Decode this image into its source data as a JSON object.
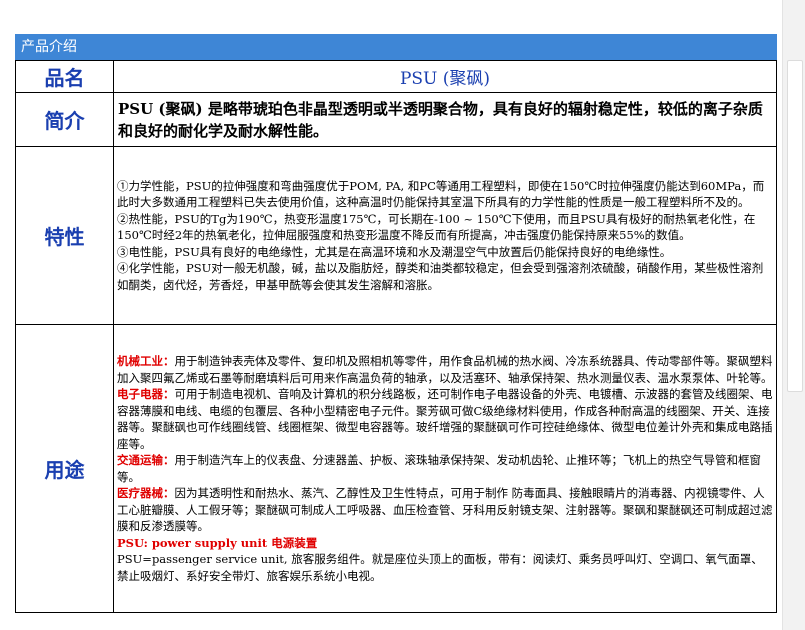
{
  "header": {
    "title": "产品介绍"
  },
  "labels": {
    "name": "品名",
    "intro": "简介",
    "features": "特性",
    "uses": "用途"
  },
  "product": {
    "name": "PSU (聚砜)",
    "intro": "PSU (聚砜) 是略带琥珀色非晶型透明或半透明聚合物，具有良好的辐射稳定性，较低的离子杂质和良好的耐化学及耐水解性能。"
  },
  "features": [
    "①力学性能，PSU的拉伸强度和弯曲强度优于POM, PA, 和PC等通用工程塑料，即使在150℃时拉伸强度仍能达到60MPa，而此时大多数通用工程塑料已失去使用价值，这种高温时仍能保持其室温下所具有的力学性能的性质是一般工程塑料所不及的。",
    "②热性能，PSU的Tg为190℃，热变形温度175℃，可长期在-100 ~ 150℃下使用，而且PSU具有极好的耐热氧老化性，在150℃时经2年的热氧老化，拉伸屈服强度和热变形温度不降反而有所提高，冲击强度仍能保持原来55%的数值。",
    "③电性能，PSU具有良好的电绝缘性，尤其是在高温环境和水及潮湿空气中放置后仍能保持良好的电绝缘性。",
    "④化学性能，PSU对一般无机酸，碱，盐以及脂肪烃，醇类和油类都较稳定，但会受到强溶剂浓硫酸，硝酸作用，某些极性溶剂如酮类，卤代烃，芳香烃，甲基甲酰等会使其发生溶解和溶胀。"
  ],
  "uses": [
    {
      "heading": "机械工业：",
      "text": "用于制造钟表壳体及零件、复印机及照相机等零件，用作食品机械的热水阀、冷冻系统器具、传动零部件等。聚砜塑料加入聚四氟乙烯或石墨等耐磨填料后可用来作高温负荷的轴承，以及活塞环、轴承保持架、热水测量仪表、温水泵泵体、叶轮等。"
    },
    {
      "heading": "电子电器：",
      "text": "可用于制造电视机、音响及计算机的积分线路板，还可制作电子电器设备的外壳、电镀槽、示波器的套管及线圈架、电容器薄膜和电线、电缆的包覆层、各种小型精密电子元件。聚芳砜可做C级绝缘材料使用，作成各种耐高温的线圈架、开关、连接器等。聚醚砜也可作线圈线管、线圈框架、微型电容器等。玻纤增强的聚醚砜可作可控硅绝缘体、微型电位差计外壳和集成电路插座等。"
    },
    {
      "heading": "交通运输：",
      "text": "用于制造汽车上的仪表盘、分速器盖、护板、滚珠轴承保持架、发动机齿轮、止推环等；飞机上的热空气导管和框窗等。"
    },
    {
      "heading": "医疗器械：",
      "text": "因为其透明性和耐热水、蒸汽、乙醇性及卫生性特点，可用于制作 防毒面具、接触眼睛片的消毒器、内视镜零件、人工心脏瓣膜、人工假牙等；聚醚砜可制成人工呼吸器、血压检查管、牙科用反射镜支架、注射器等。聚砜和聚醚砜还可制成超过滤膜和反渗透膜等。"
    },
    {
      "heading": "PSU: power supply unit 电源装置",
      "text": ""
    },
    {
      "heading": "",
      "text": "PSU=passenger service unit, 旅客服务组件。就是座位头顶上的面板，带有：阅读灯、乘务员呼叫灯、空调口、氧气面罩、禁止吸烟灯、系好安全带灯、旅客娱乐系统小电视。"
    }
  ],
  "colors": {
    "header": "#3e86d6",
    "label": "#1a3fb0",
    "accent": "#e00000"
  }
}
